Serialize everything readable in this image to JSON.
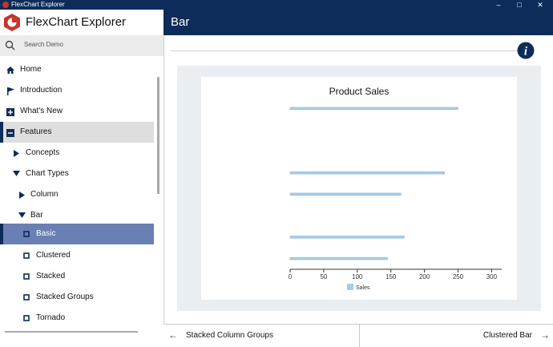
{
  "window": {
    "title": "FlexChart Explorer"
  },
  "sidebar": {
    "brand": "FlexChart Explorer",
    "search_placeholder": "Search Demo",
    "items": [
      {
        "label": "Home",
        "icon": "home-icon"
      },
      {
        "label": "Introduction",
        "icon": "flag-icon"
      },
      {
        "label": "What's New",
        "icon": "plus-box-icon"
      },
      {
        "label": "Features",
        "icon": "minus-box-icon"
      },
      {
        "label": "Concepts",
        "icon": "triangle-right-icon"
      },
      {
        "label": "Chart Types",
        "icon": "triangle-down-icon"
      },
      {
        "label": "Column",
        "icon": "triangle-right-icon"
      },
      {
        "label": "Bar",
        "icon": "triangle-down-icon"
      },
      {
        "label": "Basic",
        "icon": "square-bullet-icon"
      },
      {
        "label": "Clustered",
        "icon": "square-bullet-icon"
      },
      {
        "label": "Stacked",
        "icon": "square-bullet-icon"
      },
      {
        "label": "Stacked Groups",
        "icon": "square-bullet-icon"
      },
      {
        "label": "Tornado",
        "icon": "square-bullet-icon"
      }
    ]
  },
  "main": {
    "title": "Bar"
  },
  "footer": {
    "prev": "Stacked Column Groups",
    "next": "Clustered Bar"
  },
  "colors": {
    "navy": "#0d2c5a",
    "selected": "#6a7fb4",
    "bar": "#a8cbe8"
  },
  "chart_data": {
    "type": "bar",
    "orientation": "horizontal",
    "title": "Product Sales",
    "categories": [
      "",
      "",
      "",
      "",
      "",
      "",
      "",
      ""
    ],
    "series": [
      {
        "name": "Sales",
        "values": [
          250,
          0,
          0,
          230,
          165,
          0,
          170,
          145
        ]
      }
    ],
    "xticks": [
      0,
      50,
      100,
      150,
      200,
      250,
      300
    ],
    "xlim": [
      0,
      315
    ],
    "legend": "bottom"
  }
}
